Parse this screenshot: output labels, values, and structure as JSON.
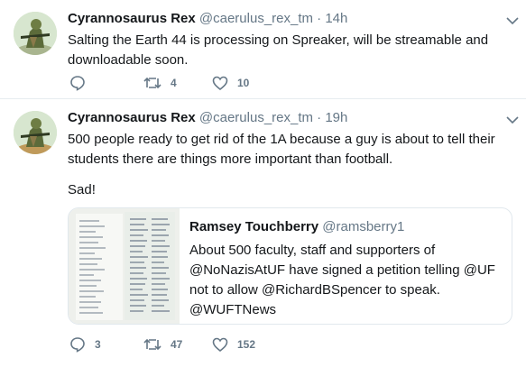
{
  "tweets": [
    {
      "author_name": "Cyrannosaurus Rex",
      "author_handle": "@caerulus_rex_tm",
      "time": "14h",
      "text": "Salting the Earth 44 is processing on Spreaker, will be streamable and downloadable soon.",
      "reply_count": "",
      "retweet_count": "4",
      "like_count": "10"
    },
    {
      "author_name": "Cyrannosaurus Rex",
      "author_handle": "@caerulus_rex_tm",
      "time": "19h",
      "text": "500 people ready to get rid of the 1A because a guy is about to tell their students there are things more important than football.",
      "text2": "Sad!",
      "reply_count": "3",
      "retweet_count": "47",
      "like_count": "152",
      "quote": {
        "author_name": "Ramsey Touchberry",
        "author_handle": "@ramsberry1",
        "text": "About 500 faculty, staff and supporters of @NoNazisAtUF have signed a petition telling @UF not to allow @RichardBSpencer to speak. @WUFTNews"
      }
    }
  ],
  "icons": {
    "reply": "reply-icon",
    "retweet": "retweet-icon",
    "like": "heart-icon",
    "menu": "chevron-down-icon"
  },
  "colors": {
    "text": "#14171a",
    "muted": "#657786",
    "border": "#e6ecf0"
  }
}
